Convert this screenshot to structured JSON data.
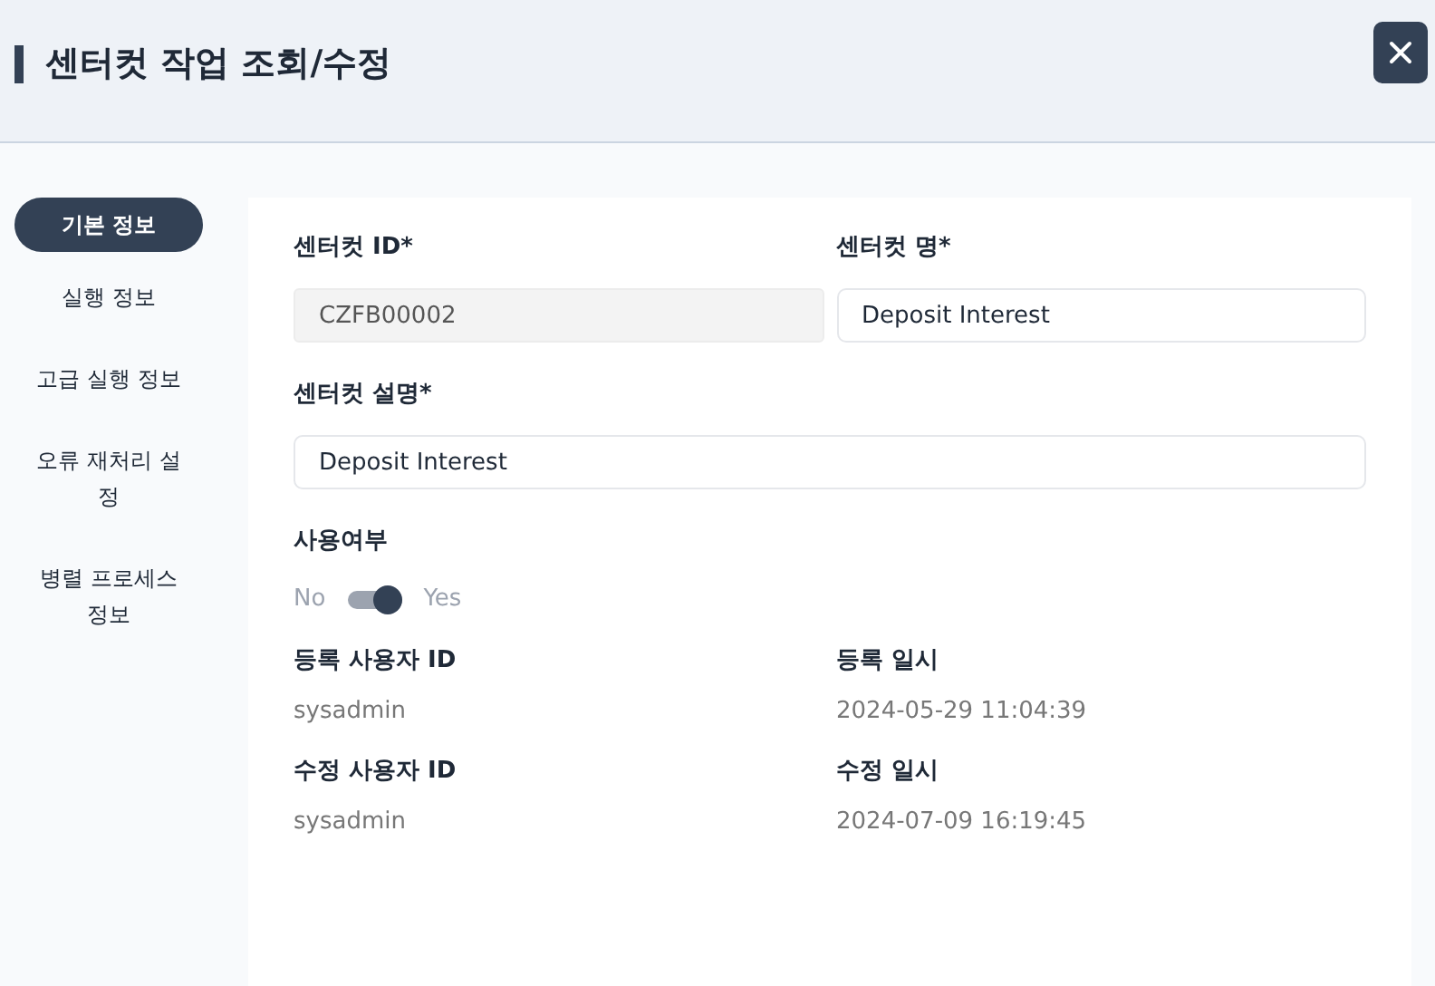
{
  "header": {
    "title": "센터컷 작업 조회/수정"
  },
  "sidebar": {
    "items": [
      {
        "label": "기본 정보",
        "selected": true
      },
      {
        "label": "실행 정보",
        "selected": false
      },
      {
        "label": "고급 실행 정보",
        "selected": false
      },
      {
        "label": "오류 재처리 설정",
        "selected": false
      },
      {
        "label": "병렬 프로세스 정보",
        "selected": false
      }
    ]
  },
  "form": {
    "fields": [
      {
        "label": "센터컷 ID*",
        "value": "CZFB00002",
        "disabled": true,
        "kind": "half"
      },
      {
        "label": "센터컷 명*",
        "value": "Deposit Interest",
        "disabled": false,
        "kind": "half"
      },
      {
        "label": "센터컷 설명*",
        "value": "Deposit Interest",
        "disabled": false,
        "kind": "full"
      }
    ],
    "toggle": {
      "label": "사용여부",
      "off_label": "No",
      "on_label": "Yes",
      "on": true
    },
    "info": [
      {
        "label": "등록 사용자 ID",
        "value": "sysadmin"
      },
      {
        "label": "등록 일시",
        "value": "2024-05-29 11:04:39"
      },
      {
        "label": "수정 사용자 ID",
        "value": "sysadmin"
      },
      {
        "label": "수정 일시",
        "value": "2024-07-09 16:19:45"
      }
    ]
  }
}
